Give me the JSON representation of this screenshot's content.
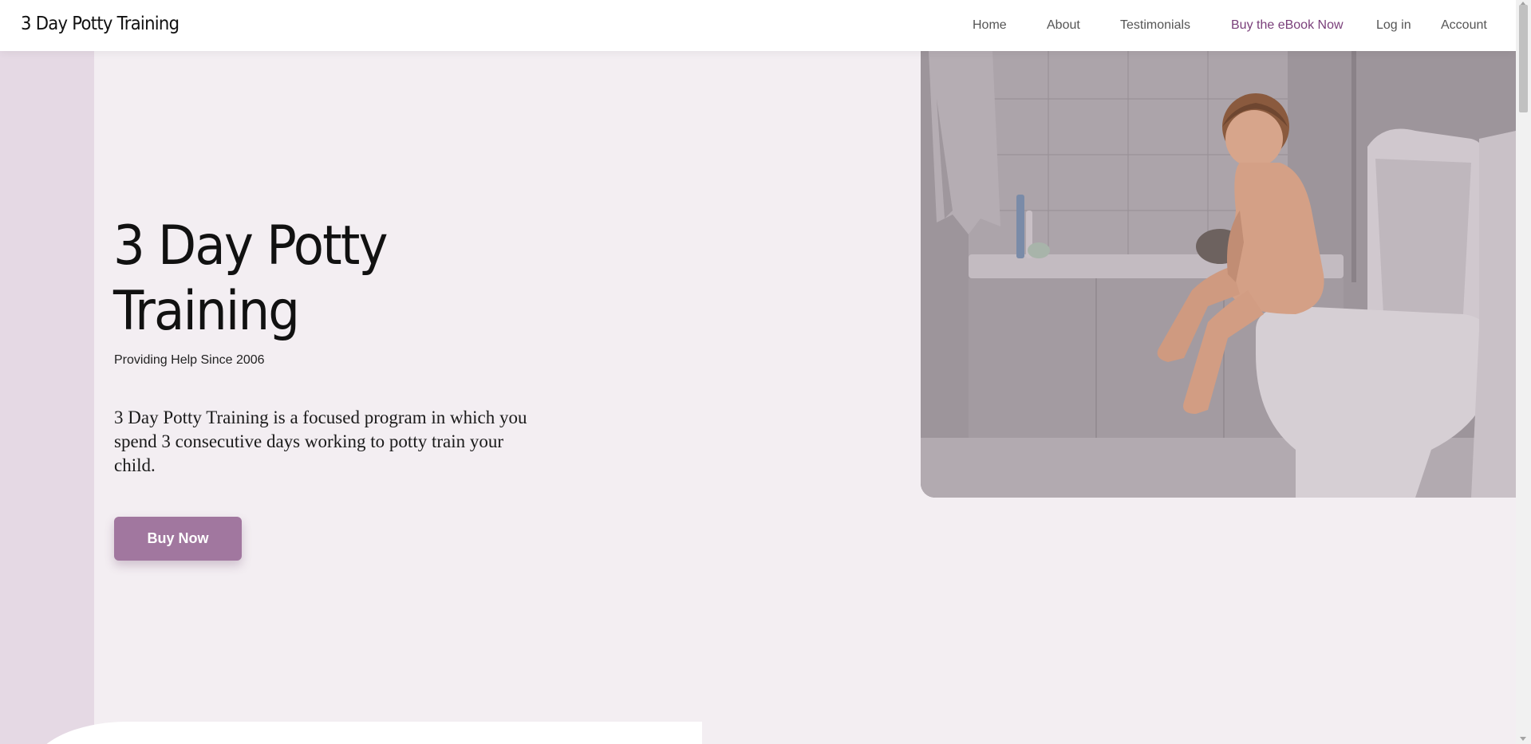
{
  "header": {
    "logo": "3 Day Potty Training",
    "nav": [
      {
        "label": "Home"
      },
      {
        "label": "About"
      },
      {
        "label": "Testimonials"
      },
      {
        "label": "Buy the eBook Now"
      },
      {
        "label": "Log in"
      },
      {
        "label": "Account"
      }
    ]
  },
  "hero": {
    "title": "3 Day Potty Training",
    "subtitle": "Providing Help Since 2006",
    "description": "3 Day Potty Training is a focused program in which you spend 3 consecutive days working to potty train your child.",
    "button_label": "Buy Now"
  },
  "colors": {
    "background": "#f3eef2",
    "side_strip": "#e5d9e4",
    "accent": "#7a3f7a",
    "button": "#a1779f"
  }
}
